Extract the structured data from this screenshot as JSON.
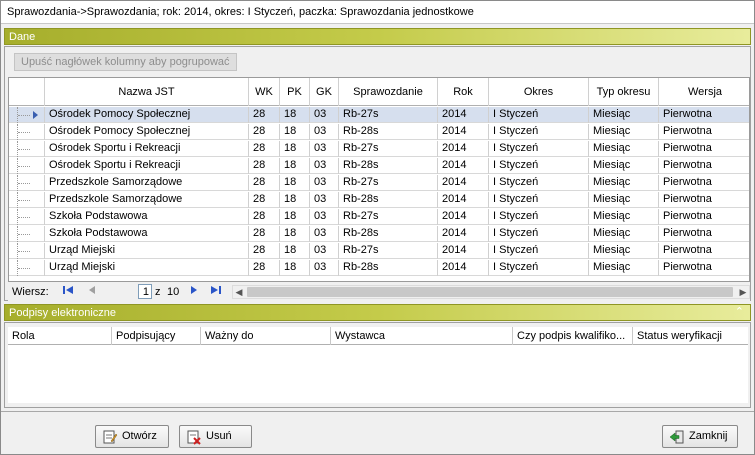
{
  "window": {
    "title": "Sprawozdania->Sprawozdania; rok: 2014, okres: I Styczeń, paczka: Sprawozdania jednostkowe"
  },
  "dane_panel": {
    "title": "Dane",
    "group_hint": "Upuść nagłówek kolumny aby pogrupować",
    "columns": [
      "Nazwa JST",
      "WK",
      "PK",
      "GK",
      "Sprawozdanie",
      "Rok",
      "Okres",
      "Typ okresu",
      "Wersja"
    ],
    "rows": [
      [
        "Ośrodek Pomocy Społecznej",
        "28",
        "18",
        "03",
        "Rb-27s",
        "2014",
        "I Styczeń",
        "Miesiąc",
        "Pierwotna"
      ],
      [
        "Ośrodek Pomocy Społecznej",
        "28",
        "18",
        "03",
        "Rb-28s",
        "2014",
        "I Styczeń",
        "Miesiąc",
        "Pierwotna"
      ],
      [
        "Ośrodek Sportu i Rekreacji",
        "28",
        "18",
        "03",
        "Rb-27s",
        "2014",
        "I Styczeń",
        "Miesiąc",
        "Pierwotna"
      ],
      [
        "Ośrodek Sportu i Rekreacji",
        "28",
        "18",
        "03",
        "Rb-28s",
        "2014",
        "I Styczeń",
        "Miesiąc",
        "Pierwotna"
      ],
      [
        "Przedszkole Samorządowe",
        "28",
        "18",
        "03",
        "Rb-27s",
        "2014",
        "I Styczeń",
        "Miesiąc",
        "Pierwotna"
      ],
      [
        "Przedszkole Samorządowe",
        "28",
        "18",
        "03",
        "Rb-28s",
        "2014",
        "I Styczeń",
        "Miesiąc",
        "Pierwotna"
      ],
      [
        "Szkoła Podstawowa",
        "28",
        "18",
        "03",
        "Rb-27s",
        "2014",
        "I Styczeń",
        "Miesiąc",
        "Pierwotna"
      ],
      [
        "Szkoła Podstawowa",
        "28",
        "18",
        "03",
        "Rb-28s",
        "2014",
        "I Styczeń",
        "Miesiąc",
        "Pierwotna"
      ],
      [
        "Urząd Miejski",
        "28",
        "18",
        "03",
        "Rb-27s",
        "2014",
        "I Styczeń",
        "Miesiąc",
        "Pierwotna"
      ],
      [
        "Urząd Miejski",
        "28",
        "18",
        "03",
        "Rb-28s",
        "2014",
        "I Styczeń",
        "Miesiąc",
        "Pierwotna"
      ]
    ],
    "selected_row": 0,
    "navigator": {
      "label": "Wiersz:",
      "current_page": "1",
      "of_label": "z",
      "total": "10"
    }
  },
  "podpisy_panel": {
    "title": "Podpisy elektroniczne",
    "columns": [
      "Rola",
      "Podpisujący",
      "Ważny do",
      "Wystawca",
      "Czy podpis kwalifiko...",
      "Status weryfikacji"
    ]
  },
  "buttons": {
    "open": "Otwórz",
    "delete": "Usuń",
    "close": "Zamknij"
  },
  "icons": {
    "first": "first-page-icon",
    "prev": "prev-page-icon",
    "next": "next-page-icon",
    "last": "last-page-icon",
    "collapse": "collapse-up-icon",
    "open": "edit-document-icon",
    "delete": "delete-document-icon",
    "close": "exit-door-icon"
  },
  "colors": {
    "panel_header": "#b3ba34",
    "selected_row": "#d6dfee",
    "nav_accent": "#2a55c8"
  }
}
